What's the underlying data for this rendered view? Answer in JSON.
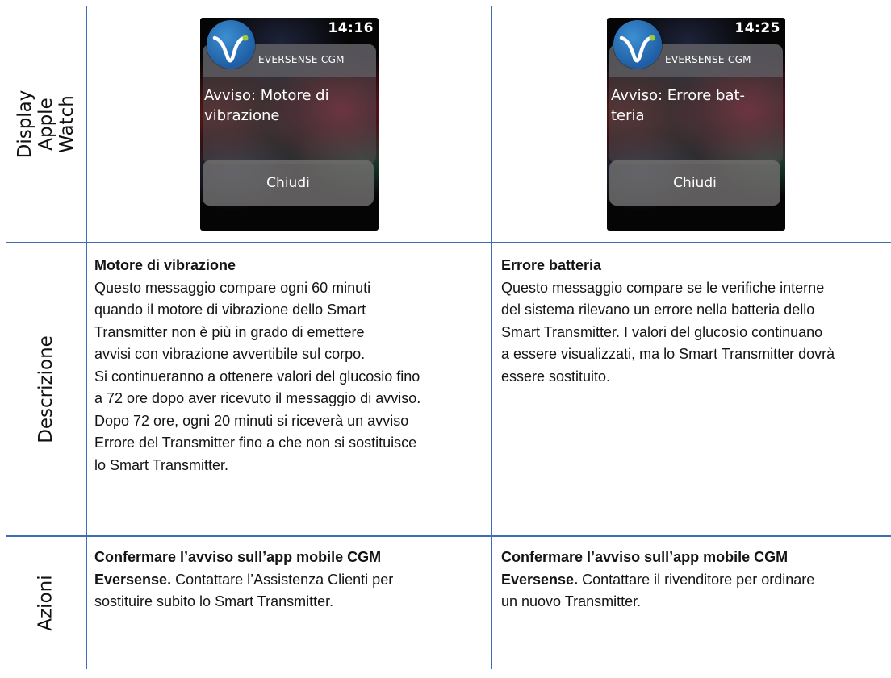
{
  "row_labels": {
    "display": "Display\nApple Watch",
    "descrizione": "Descrizione",
    "azioni": "Azioni"
  },
  "columns": [
    {
      "watch": {
        "time": "14:16",
        "brand": "EVERSENSE CGM",
        "message": "Avviso:  Motore di\nvibrazione",
        "button": "Chiudi"
      },
      "descrizione": {
        "title": "Motore di vibrazione",
        "text": "Questo messaggio compare ogni 60 minuti\nquando il motore di vibrazione dello Smart\nTransmitter non è più in grado di emettere\navvisi con vibrazione avvertibile sul corpo.\nSi continueranno a ottenere valori del glucosio fino\na 72 ore dopo aver ricevuto il messaggio di avviso.\nDopo 72 ore, ogni 20 minuti si riceverà un avviso\nErrore del Transmitter fino a che non si sostituisce\nlo Smart Transmitter."
      },
      "azioni": {
        "bold": "Confermare l’avviso sull’app mobile CGM\nEversense.",
        "text": " Contattare l’Assistenza Clienti per\nsostituire subito lo Smart Transmitter."
      }
    },
    {
      "watch": {
        "time": "14:25",
        "brand": "EVERSENSE CGM",
        "message": "Avviso:  Errore bat-\nteria",
        "button": "Chiudi"
      },
      "descrizione": {
        "title": "Errore batteria",
        "text": "Questo messaggio compare se le verifiche interne\ndel sistema rilevano un errore nella batteria dello\nSmart Transmitter. I valori del glucosio continuano\na essere visualizzati, ma lo Smart Transmitter dovrà\nessere sostituito."
      },
      "azioni": {
        "bold": "Confermare l’avviso sull’app mobile CGM\nEversense.",
        "text": " Contattare il rivenditore per ordinare\nun nuovo Transmitter."
      }
    }
  ],
  "colors": {
    "grid_line": "#3d6fb5",
    "logo_blue": "#1f5ea4",
    "logo_curve": "#ffffff",
    "logo_dot": "#9cc93b"
  },
  "icons": {
    "logo": "eversense-logo-icon"
  }
}
